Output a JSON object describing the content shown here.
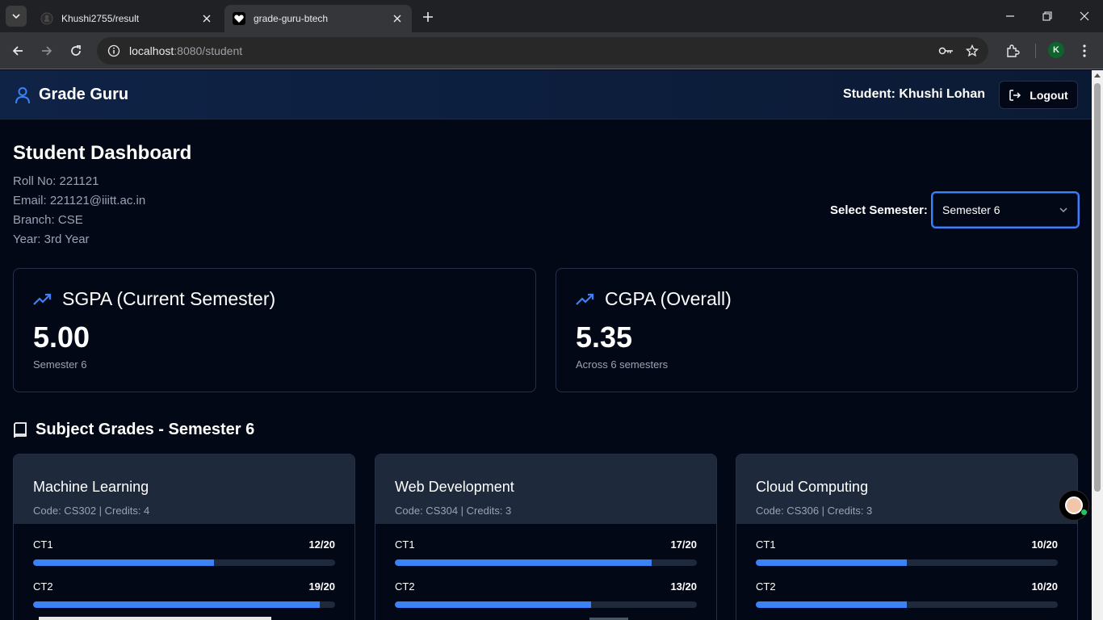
{
  "browser": {
    "tabs": [
      {
        "title": "Khushi2755/result",
        "active": false,
        "icon": "github-icon"
      },
      {
        "title": "grade-guru-btech",
        "active": true,
        "icon": "heart-icon"
      }
    ],
    "url_host": "localhost",
    "url_path": ":8080/student",
    "profile_initial": "K"
  },
  "header": {
    "brand": "Grade Guru",
    "student_label": "Student: Khushi Lohan",
    "logout_label": "Logout"
  },
  "dashboard": {
    "title": "Student Dashboard",
    "roll": "Roll No: 221121",
    "email": "Email: 221121@iiitt.ac.in",
    "branch": "Branch: CSE",
    "year": "Year: 3rd Year",
    "semester_label": "Select Semester:",
    "semester_value": "Semester 6"
  },
  "sgpa": {
    "title": "SGPA (Current Semester)",
    "value": "5.00",
    "sub": "Semester 6"
  },
  "cgpa": {
    "title": "CGPA (Overall)",
    "value": "5.35",
    "sub": "Across 6 semesters"
  },
  "subject_grades_title": "Subject Grades - Semester 6",
  "subjects": [
    {
      "name": "Machine Learning",
      "meta": "Code: CS302 | Credits: 4",
      "tests": [
        {
          "label": "CT1",
          "score": "12/20",
          "fraction": 0.6
        },
        {
          "label": "CT2",
          "score": "19/20",
          "fraction": 0.95
        }
      ]
    },
    {
      "name": "Web Development",
      "meta": "Code: CS304 | Credits: 3",
      "tests": [
        {
          "label": "CT1",
          "score": "17/20",
          "fraction": 0.85
        },
        {
          "label": "CT2",
          "score": "13/20",
          "fraction": 0.65
        }
      ]
    },
    {
      "name": "Cloud Computing",
      "meta": "Code: CS306 | Credits: 3",
      "tests": [
        {
          "label": "CT1",
          "score": "10/20",
          "fraction": 0.5
        },
        {
          "label": "CT2",
          "score": "10/20",
          "fraction": 0.5
        }
      ]
    }
  ],
  "colors": {
    "accent": "#3b82f6",
    "background": "#030817",
    "card_header": "#1e293b"
  }
}
